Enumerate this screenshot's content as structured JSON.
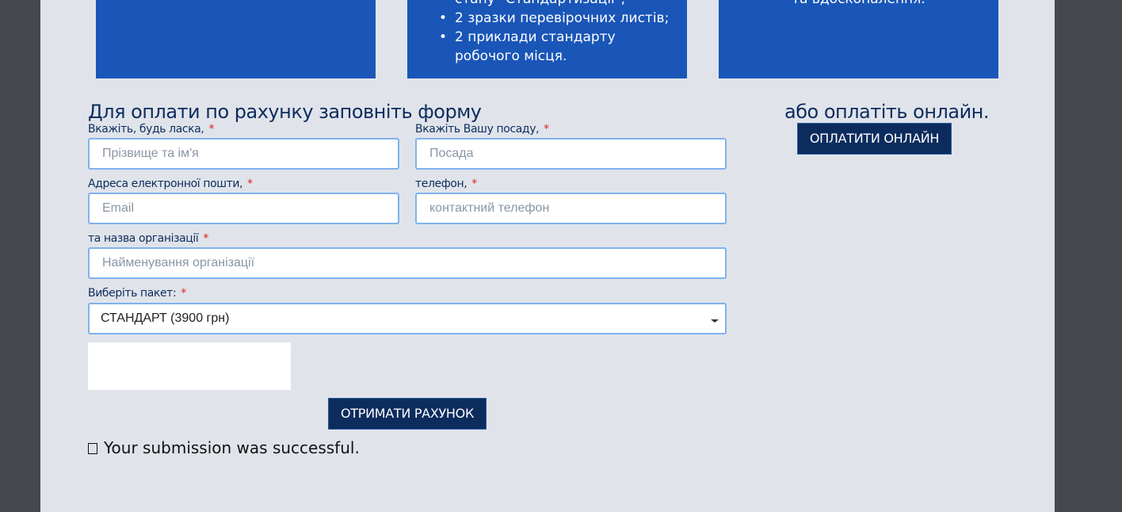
{
  "cards": {
    "card2_items": [
      "стану \"Стандартизації\";",
      "2 зразки перевірочних листів;",
      "2 приклади стандарту робочого місця."
    ],
    "card3_text": "та вдосконалення."
  },
  "form": {
    "title": "Для оплати по рахунку заповніть форму",
    "labels": {
      "name": "Вкажіть, будь ласка,",
      "position": "Вкажіть Вашу посаду,",
      "email": "Адреса електронної пошти,",
      "phone": "телефон,",
      "org": "та назва організації",
      "package": "Виберіть пакет:"
    },
    "required_mark": "*",
    "placeholders": {
      "name": "Прізвище та ім'я",
      "position": "Посада",
      "email": "Email",
      "phone": "контактний телефон",
      "org": "Найменування організації"
    },
    "package_selected": "СТАНДАРТ (3900 грн)",
    "submit_label": "ОТРИМАТИ РАХУНОК",
    "success_message": "Your submission was successful."
  },
  "online": {
    "title": "або оплатіть онлайн.",
    "button_label": "ОПЛАТИТИ ОНЛАЙН"
  },
  "colors": {
    "card_blue": "#1a56b8",
    "navy": "#0d2c5e",
    "page_bg": "#e0e4ea",
    "outer_bg": "#45484f",
    "required_red": "#e02020"
  }
}
